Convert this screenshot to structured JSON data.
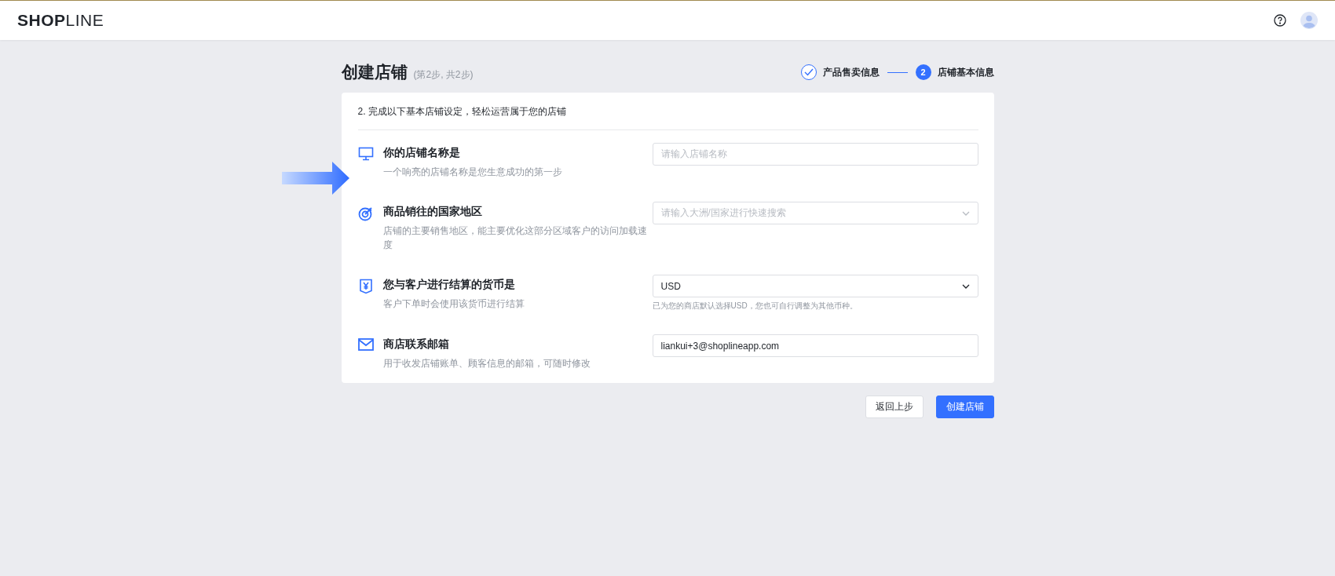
{
  "header": {
    "logo": "**SHOP**LINE"
  },
  "page": {
    "title": "创建店铺",
    "subtitle": "(第2步, 共2步)"
  },
  "steps": [
    {
      "label": "产品售卖信息",
      "completed": true
    },
    {
      "label": "店铺基本信息",
      "completed": false,
      "number": "2"
    }
  ],
  "card": {
    "heading": "2. 完成以下基本店铺设定，轻松运营属于您的店铺",
    "rows": [
      {
        "label": "你的店铺名称是",
        "description": "一个响亮的店铺名称是您生意成功的第一步",
        "field": {
          "kind": "input",
          "placeholder": "请输入店铺名称"
        }
      },
      {
        "label": "商品销往的国家地区",
        "description": "店铺的主要销售地区，能主要优化这部分区域客户的访问加载速度",
        "field": {
          "kind": "select",
          "placeholder": "请输入大洲/国家进行快速搜索"
        }
      },
      {
        "label": "您与客户进行结算的货币是",
        "description": "客户下单时会使用该货币进行结算",
        "field": {
          "kind": "select",
          "value": "USD",
          "hint": "已为您的商店默认选择USD，您也可自行调整为其他币种。"
        }
      },
      {
        "label": "商店联系邮箱",
        "description": "用于收发店铺账单、顾客信息的邮箱，可随时修改",
        "field": {
          "kind": "input",
          "value": "liankui+3@shoplineapp.com"
        }
      }
    ]
  },
  "buttons": [
    {
      "label": "返回上步",
      "kind": "secondary"
    },
    {
      "label": "创建店铺",
      "kind": "primary"
    }
  ]
}
